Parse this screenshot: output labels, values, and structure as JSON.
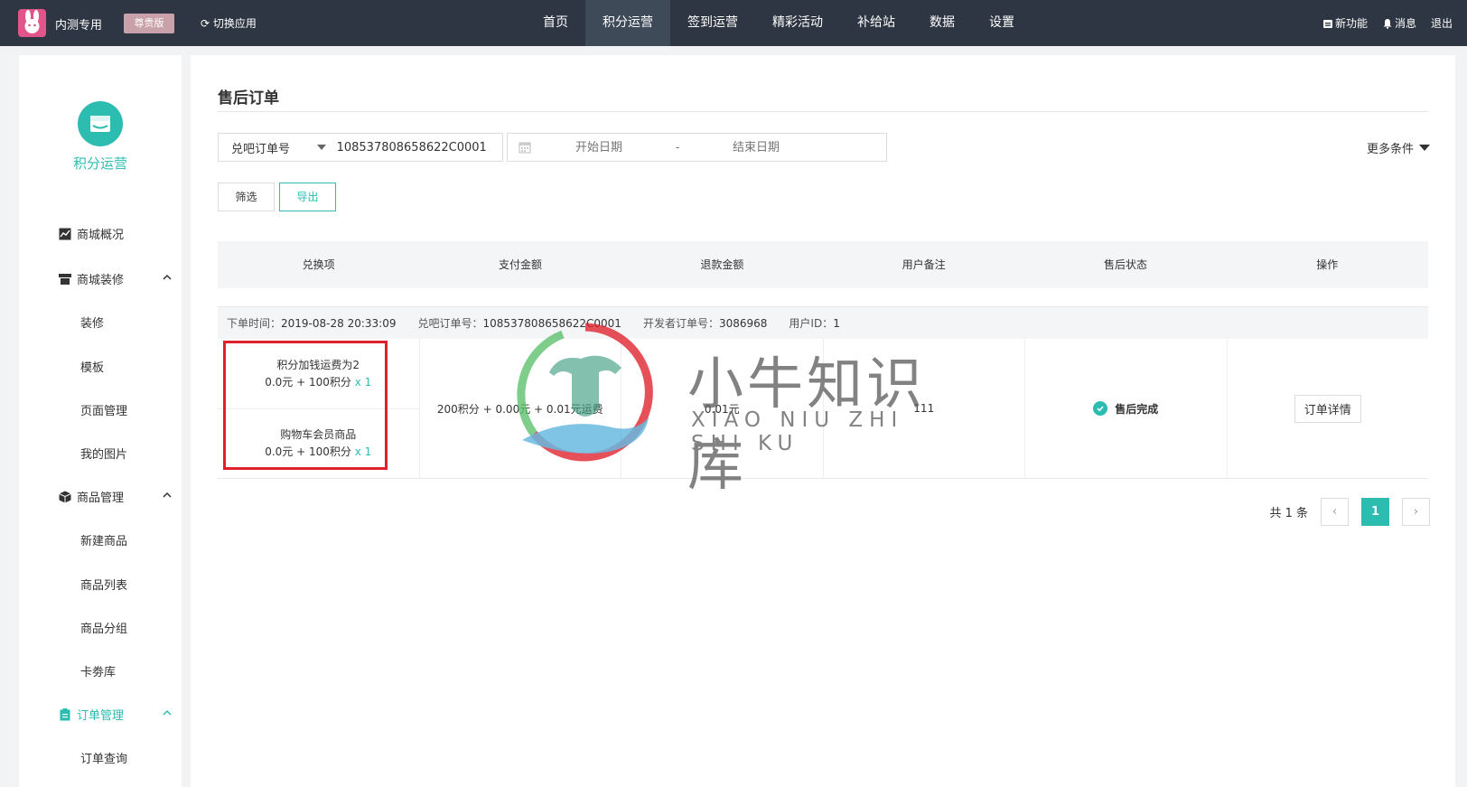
{
  "topbar": {
    "brand": "内测专用",
    "badge": "尊贵版",
    "switch_app": "切换应用",
    "nav": [
      "首页",
      "积分运营",
      "签到运营",
      "精彩活动",
      "补给站",
      "数据",
      "设置"
    ],
    "active_nav": "积分运营",
    "new_feature": "新功能",
    "messages": "消息",
    "logout": "退出"
  },
  "sidebar": {
    "app_name": "积分运营",
    "items": {
      "mall_overview": "商城概况",
      "mall_decor": "商城装修",
      "decor": "装修",
      "template": "模板",
      "page_manage": "页面管理",
      "my_images": "我的图片",
      "goods_manage": "商品管理",
      "new_goods": "新建商品",
      "goods_list": "商品列表",
      "goods_group": "商品分组",
      "coupon_lib": "卡劵库",
      "order_manage": "订单管理",
      "order_query": "订单查询"
    }
  },
  "main": {
    "title": "售后订单",
    "filter": {
      "select_label": "兑吧订单号",
      "select_value": "108537808658622C0001",
      "start_placeholder": "开始日期",
      "dash": "-",
      "end_placeholder": "结束日期",
      "more": "更多条件",
      "btn_filter": "筛选",
      "btn_export": "导出"
    },
    "table": {
      "headers": [
        "兑换项",
        "支付金额",
        "退款金额",
        "用户备注",
        "售后状态",
        "操作"
      ]
    },
    "order": {
      "time_label": "下单时间：",
      "time_value": "2019-08-28 20:33:09",
      "duiba_label": "兑吧订单号：",
      "duiba_value": "108537808658622C0001",
      "dev_label": "开发者订单号：",
      "dev_value": "3086968",
      "uid_label": "用户ID：",
      "uid_value": "1",
      "items": [
        {
          "name": "积分加钱运费为2",
          "price": "0.0元 +  100积分",
          "qty": "x 1"
        },
        {
          "name": "购物车会员商品",
          "price": "0.0元 +  100积分",
          "qty": "x 1"
        }
      ],
      "pay_amount": "200积分 + 0.00元 + 0.01元运费",
      "refund_amount": "0.01元",
      "user_note": "111",
      "status": "售后完成",
      "action": "订单详情"
    },
    "pagination": {
      "total": "共 1 条",
      "current": "1"
    }
  },
  "watermark": {
    "cn": "小牛知识库",
    "en": "XIAO NIU ZHI SHI KU"
  },
  "colors": {
    "topbar": "#2d3642",
    "accent": "#2cbcb0",
    "highlight": "#e0202b"
  }
}
